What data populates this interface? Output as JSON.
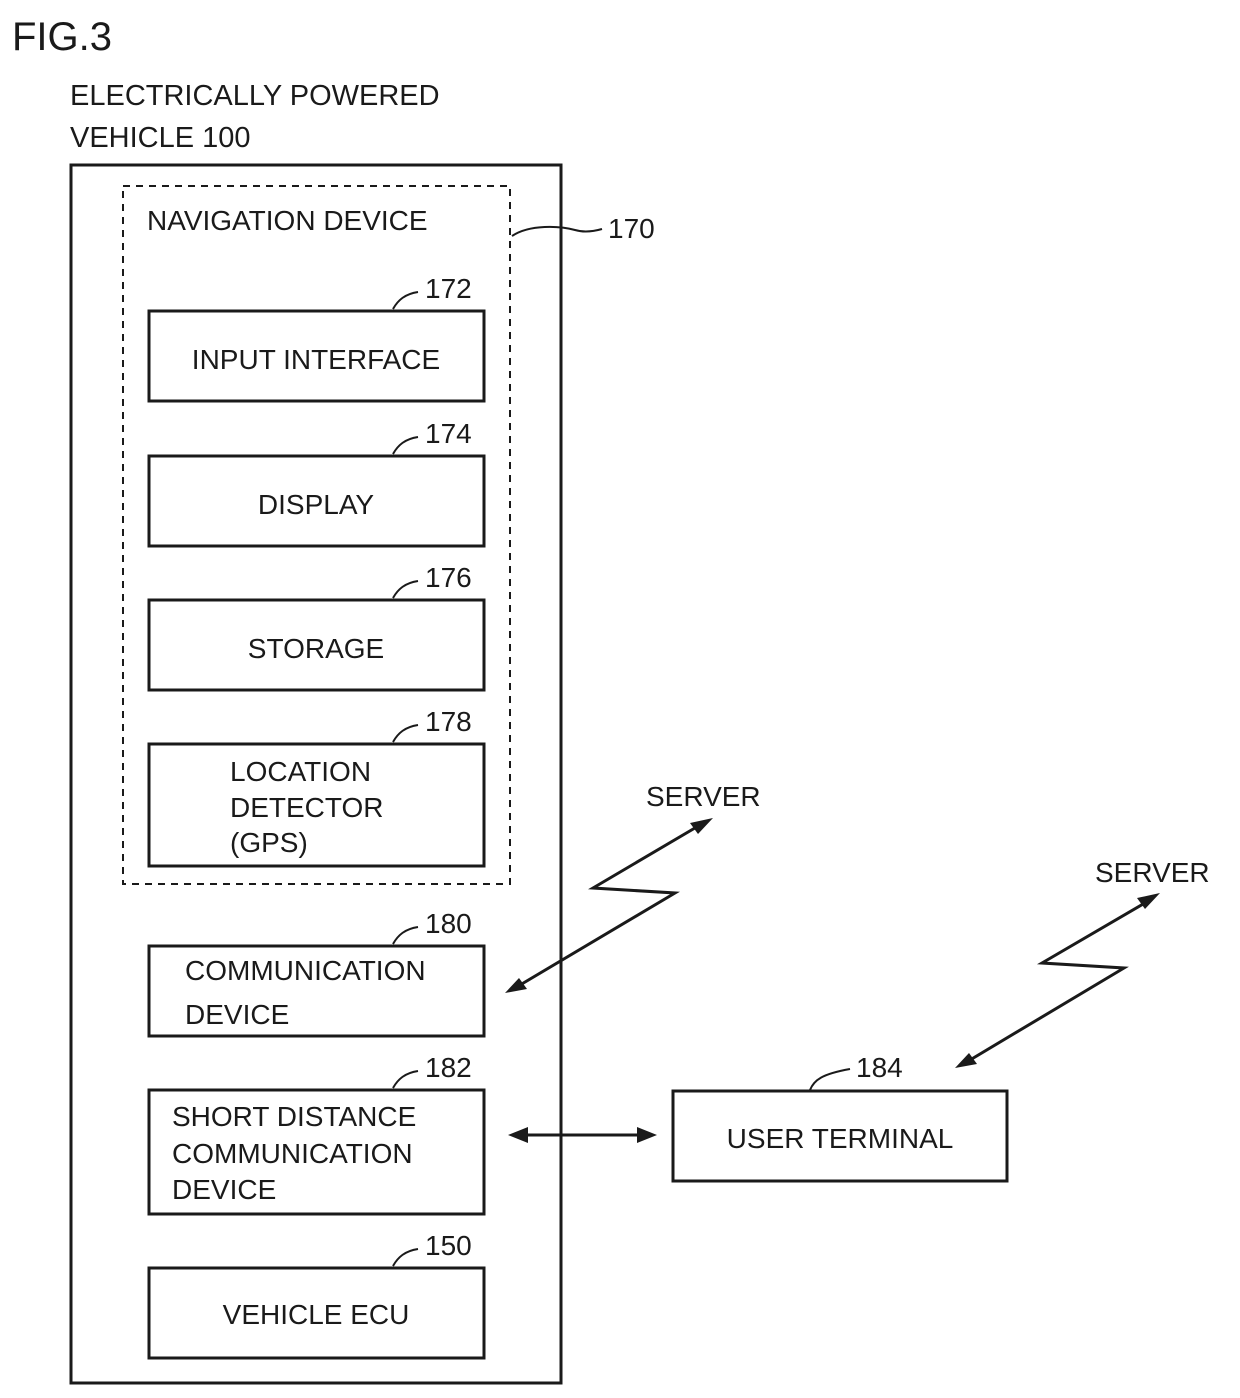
{
  "figure_label": "FIG.3",
  "vehicle": {
    "title_line1": "ELECTRICALLY POWERED",
    "title_line2": "VEHICLE 100"
  },
  "navigation_device": {
    "label": "NAVIGATION DEVICE",
    "ref": "170",
    "components": [
      {
        "ref": "172",
        "lines": [
          "INPUT INTERFACE"
        ]
      },
      {
        "ref": "174",
        "lines": [
          "DISPLAY"
        ]
      },
      {
        "ref": "176",
        "lines": [
          "STORAGE"
        ]
      },
      {
        "ref": "178",
        "lines": [
          "LOCATION",
          "DETECTOR",
          "(GPS)"
        ]
      }
    ]
  },
  "blocks": [
    {
      "ref": "180",
      "lines": [
        "COMMUNICATION",
        "DEVICE"
      ]
    },
    {
      "ref": "182",
      "lines": [
        "SHORT DISTANCE",
        "COMMUNICATION",
        "DEVICE"
      ]
    },
    {
      "ref": "150",
      "lines": [
        "VEHICLE ECU"
      ]
    }
  ],
  "user_terminal": {
    "ref": "184",
    "label": "USER TERMINAL"
  },
  "servers": [
    {
      "label": "SERVER"
    },
    {
      "label": "SERVER"
    }
  ]
}
